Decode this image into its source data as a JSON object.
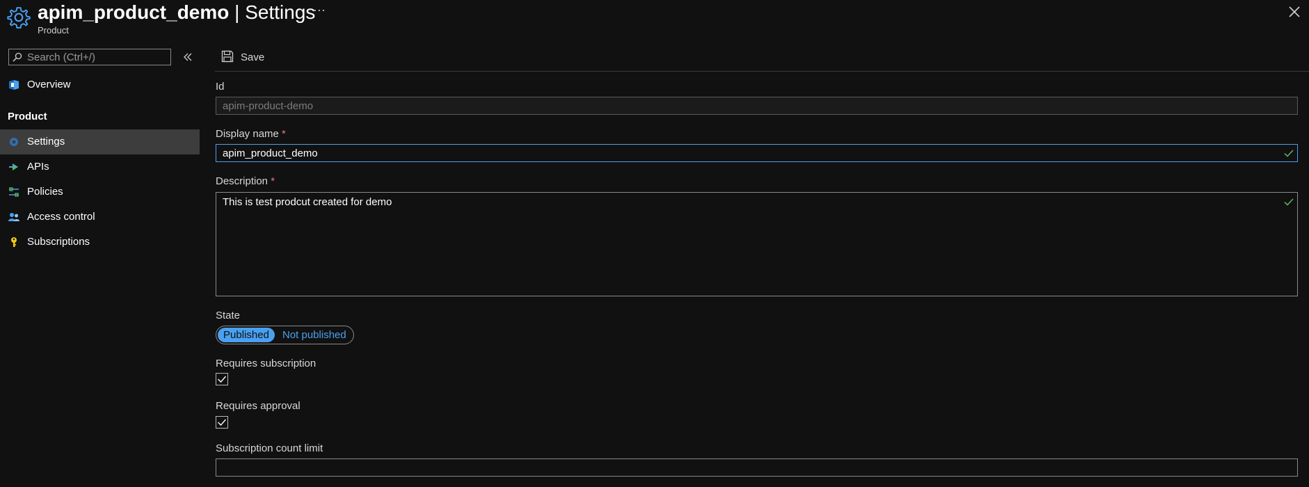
{
  "header": {
    "title": "apim_product_demo",
    "separator": "|",
    "section": "Settings",
    "more": "···",
    "subtitle": "Product"
  },
  "sidebar": {
    "search_placeholder": "Search (Ctrl+/)",
    "overview_label": "Overview",
    "section_label": "Product",
    "items": [
      {
        "label": "Settings",
        "icon": "gear-icon",
        "active": true
      },
      {
        "label": "APIs",
        "icon": "api-icon"
      },
      {
        "label": "Policies",
        "icon": "policies-icon"
      },
      {
        "label": "Access control",
        "icon": "people-icon"
      },
      {
        "label": "Subscriptions",
        "icon": "key-icon"
      }
    ]
  },
  "toolbar": {
    "save_label": "Save"
  },
  "form": {
    "id": {
      "label": "Id",
      "value": "apim-product-demo"
    },
    "display_name": {
      "label": "Display name",
      "required_mark": "*",
      "value": "apim_product_demo"
    },
    "description": {
      "label": "Description",
      "required_mark": "*",
      "value": "This is test prodcut created for demo"
    },
    "state": {
      "label": "State",
      "options": [
        "Published",
        "Not published"
      ],
      "selected": "Published"
    },
    "requires_subscription": {
      "label": "Requires subscription",
      "checked": true
    },
    "requires_approval": {
      "label": "Requires approval",
      "checked": true
    },
    "subscription_count_limit": {
      "label": "Subscription count limit",
      "value": ""
    }
  },
  "colors": {
    "background": "#111111",
    "accent": "#4aa0f0",
    "required": "#f1707b",
    "valid": "#5cb85c",
    "active_nav": "#3d3d3d"
  }
}
